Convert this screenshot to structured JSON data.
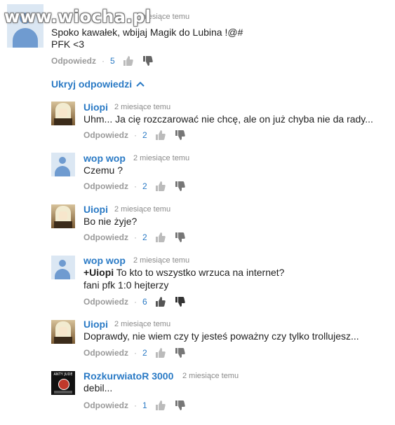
{
  "watermark": "www.wiocha.pl",
  "top_comment": {
    "time": "2 miesiące temu",
    "lines": [
      "Spoko kawałek, wbijaj Magik do Lubina !@#",
      "PFK <3"
    ],
    "reply_label": "Odpowiedz",
    "likes": "5"
  },
  "hide_replies_label": "Ukryj odpowiedzi",
  "replies": [
    {
      "author": "Uiopi",
      "time": "2 miesiące temu",
      "text": "Uhm... Ja cię rozczarować nie chcę, ale on już chyba nie da rady...",
      "reply_label": "Odpowiedz",
      "likes": "2"
    },
    {
      "author": "wop wop",
      "time": "2 miesiące temu",
      "text": "Czemu ?",
      "reply_label": "Odpowiedz",
      "likes": "2"
    },
    {
      "author": "Uiopi",
      "time": "2 miesiące temu",
      "text": "Bo nie żyje?",
      "reply_label": "Odpowiedz",
      "likes": "2"
    },
    {
      "author": "wop wop",
      "time": "2 miesiące temu",
      "mention": "+Uiopi",
      "text": " To kto to wszystko wrzuca na internet?",
      "text2": "fani pfk 1:0 hejterzy",
      "reply_label": "Odpowiedz",
      "likes": "6"
    },
    {
      "author": "Uiopi",
      "time": "2 miesiące temu",
      "text": "Doprawdy, nie wiem czy ty jesteś poważny czy tylko trollujesz...",
      "reply_label": "Odpowiedz",
      "likes": "2"
    },
    {
      "author": "RozkurwiatoR 3000",
      "time": "2 miesiące temu",
      "text": "debil...",
      "reply_label": "Odpowiedz",
      "likes": "1"
    }
  ],
  "rozk_avatar_text": "ANTY JUDE"
}
